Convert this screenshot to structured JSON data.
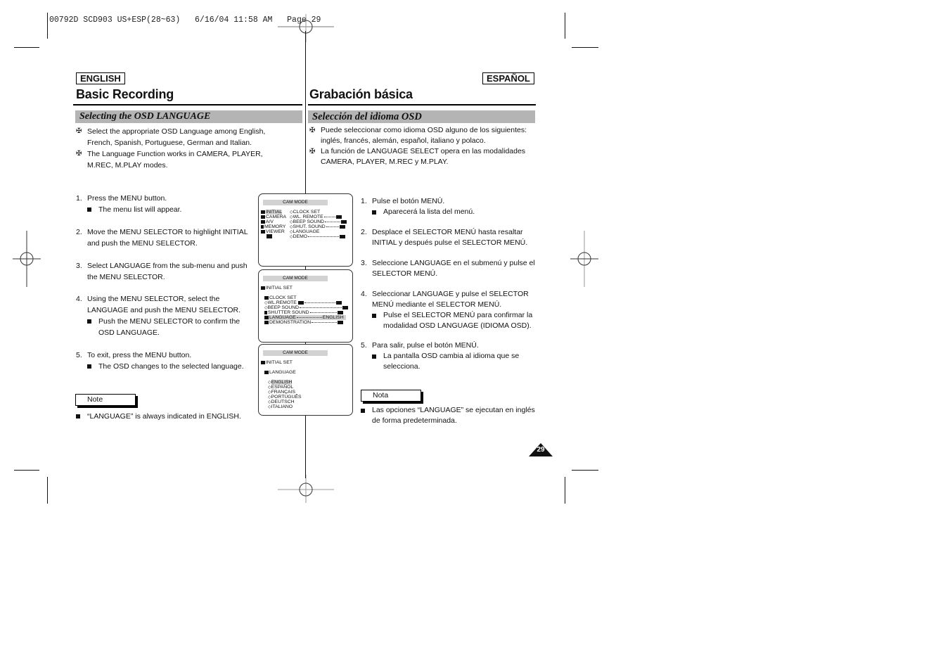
{
  "slug": {
    "text": "00792D SCD903 US+ESP(28~63)   6/16/04 11:58 AM   Page 29"
  },
  "english": {
    "lang_label": "ENGLISH",
    "title": "Basic Recording",
    "section": "Selecting the OSD LANGUAGE",
    "intro": [
      "Select the appropriate OSD Language among English, French, Spanish, Portuguese, German and Italian.",
      "The Language Function works in CAMERA, PLAYER, M.REC, M.PLAY modes."
    ],
    "steps": [
      {
        "num": "1.",
        "text": "Press the MENU button.",
        "sub": "The menu list will appear."
      },
      {
        "num": "2.",
        "text": "Move the MENU SELECTOR to highlight INITIAL and push the MENU SELECTOR.",
        "sub": null
      },
      {
        "num": "3.",
        "text": "Select LANGUAGE from the sub-menu and push the MENU SELECTOR.",
        "sub": null
      },
      {
        "num": "4.",
        "text": "Using the MENU SELECTOR, select the LANGUAGE and push the MENU SELECTOR.",
        "sub": "Push the MENU SELECTOR to confirm the OSD LANGUAGE."
      },
      {
        "num": "5.",
        "text": "To exit, press the MENU button.",
        "sub": "The OSD changes to the selected language."
      }
    ],
    "note_label": "Note",
    "note_text": "“LANGUAGE” is always indicated in ENGLISH."
  },
  "spanish": {
    "lang_label": "ESPAÑOL",
    "title": "Grabación básica",
    "section": "Selección del idioma OSD",
    "intro": [
      "Puede seleccionar como idioma OSD alguno de los siguientes: inglés, francés, alemán, español, italiano y polaco.",
      "La función de LANGUAGE SELECT opera en las modalidades CAMERA, PLAYER, M.REC y M.PLAY."
    ],
    "steps": [
      {
        "num": "1.",
        "text": "Pulse el botón MENÚ.",
        "sub": "Aparecerá la lista del menú."
      },
      {
        "num": "2.",
        "text": "Desplace el SELECTOR MENÚ hasta resaltar INITIAL y después pulse el SELECTOR MENÚ.",
        "sub": null
      },
      {
        "num": "3.",
        "text": "Seleccione LANGUAGE en el submenú y pulse el SELECTOR MENÚ.",
        "sub": null
      },
      {
        "num": "4.",
        "text": "Seleccionar LANGUAGE y pulse el SELECTOR MENÚ mediante el SELECTOR MENÚ.",
        "sub": "Pulse el SELECTOR MENÚ para confirmar la modalidad OSD LANGUAGE (IDIOMA OSD)."
      },
      {
        "num": "5.",
        "text": "Para salir, pulse el botón MENÚ.",
        "sub": "La pantalla OSD cambia al idioma que se selecciona."
      }
    ],
    "note_label": "Nota",
    "note_text": "Las opciones “LANGUAGE” se ejecutan en inglés de forma predeterminada."
  },
  "osd_screens": [
    {
      "mode": "CAM  MODE",
      "left_menu": [
        "INITIAL",
        "CAMERA",
        "A/V",
        "MEMORY",
        "VIEWER"
      ],
      "highlight": "INITIAL",
      "right_menu": [
        "CLOCK  SET",
        "WL. REMOTE",
        "BEEP SOUND",
        "SHUT. SOUND",
        "LANGUAGE",
        "DEMO"
      ]
    },
    {
      "mode": "CAM  MODE",
      "header": "INITIAL SET",
      "items": [
        "CLOCK  SET",
        "WL.REMOTE",
        "BEEP SOUND",
        "SHUTTER SOUND",
        "LANGUAGE",
        "DEMONSTRATION"
      ],
      "highlight": "LANGUAGE",
      "language_value": "ENGLISH"
    },
    {
      "mode": "CAM  MODE",
      "header": "INITIAL SET",
      "submenu": "LANGUAGE",
      "options": [
        "ENGLISH",
        "ESPAÑOL",
        "FRANÇAIS",
        "PORTUGUÊS",
        "DEUTSCH",
        "ITALIANO"
      ],
      "highlight": "ENGLISH"
    }
  ],
  "page_number": "29",
  "icons": {
    "bullet_cross": "✠"
  }
}
